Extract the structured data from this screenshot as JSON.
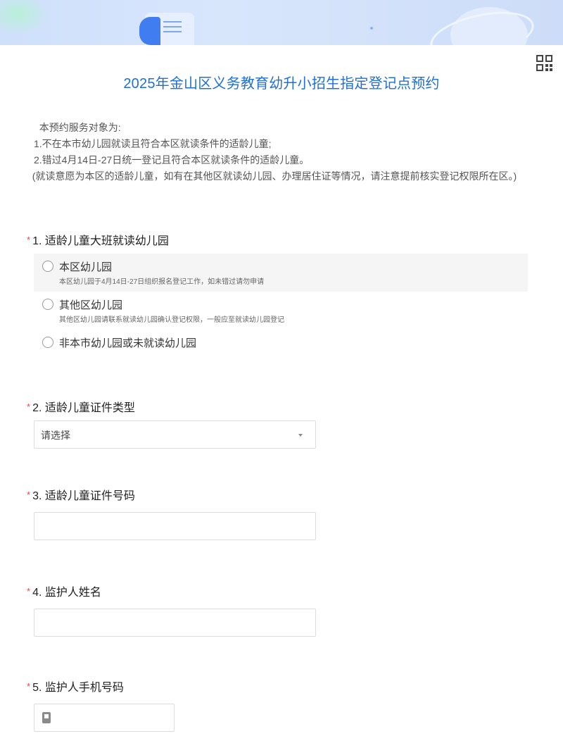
{
  "title": "2025年金山区义务教育幼升小招生指定登记点预约",
  "intro": [
    "  本预约服务对象为:",
    "1.不在本市幼儿园就读且符合本区就读条件的适龄儿童;",
    "2.错过4月14日-27日统一登记且符合本区就读条件的适龄儿童。",
    "  (就读意愿为本区的适龄儿童，如有在其他区就读幼儿园、办理居住证等情况，请注意提前核实登记权限所在区。)"
  ],
  "required_mark": "*",
  "q1": {
    "label": "1. 适龄儿童大班就读幼儿园",
    "options": [
      {
        "text": "本区幼儿园",
        "desc": "本区幼儿园于4月14日-27日组织报名登记工作，如未错过请勿申请"
      },
      {
        "text": "其他区幼儿园",
        "desc": "其他区幼儿园请联系就读幼儿园确认登记权限，一般应至就读幼儿园登记"
      },
      {
        "text": "非本市幼儿园或未就读幼儿园",
        "desc": ""
      }
    ]
  },
  "q2": {
    "label": "2. 适龄儿童证件类型",
    "select_value": "请选择"
  },
  "q3": {
    "label": "3. 适龄儿童证件号码",
    "value": ""
  },
  "q4": {
    "label": "4. 监护人姓名",
    "value": ""
  },
  "q5": {
    "label": "5. 监护人手机号码",
    "value": "",
    "icon": "phone-icon"
  },
  "colors": {
    "title": "#1f6fd6",
    "required": "#e5484d",
    "banner": "#cfe0fb"
  }
}
